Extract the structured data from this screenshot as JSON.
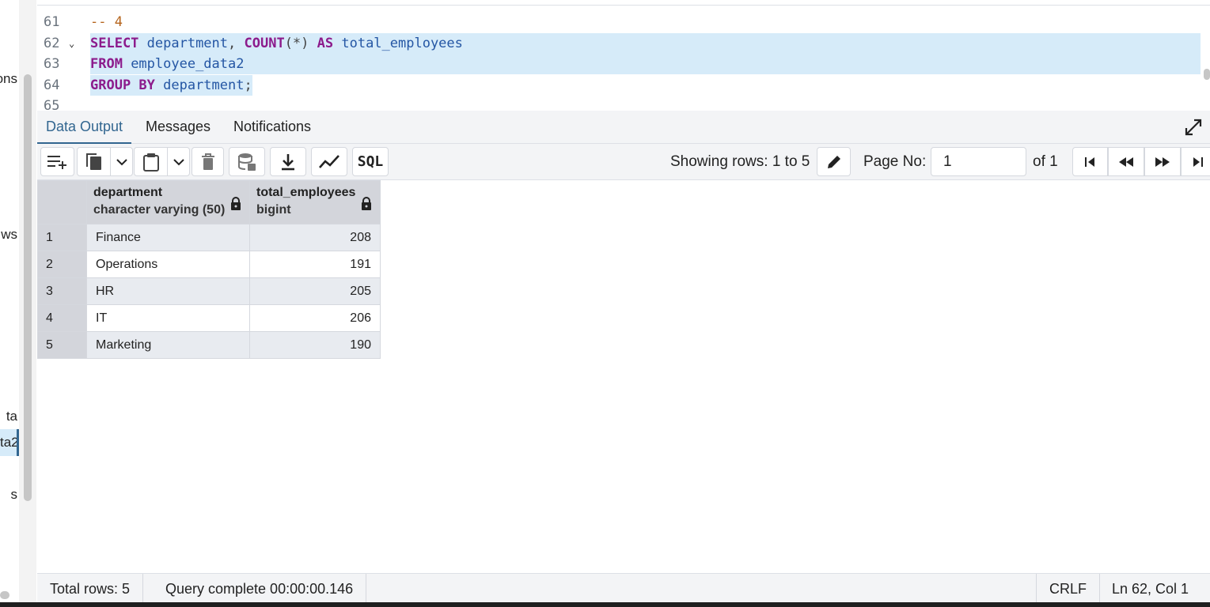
{
  "sidebar": {
    "fragments": [
      "ons",
      "ws",
      "ta",
      "ta2",
      "s"
    ]
  },
  "editor": {
    "lines": [
      {
        "num": "61",
        "tokens": [
          {
            "t": "cm",
            "v": "-- 4"
          }
        ]
      },
      {
        "num": "62",
        "fold": "⌄",
        "highlight": true,
        "tokens": [
          {
            "t": "kw",
            "v": "SELECT"
          },
          {
            "t": "id",
            "v": " department"
          },
          {
            "t": "pu",
            "v": ", "
          },
          {
            "t": "kw",
            "v": "COUNT"
          },
          {
            "t": "pu",
            "v": "(*) "
          },
          {
            "t": "kw",
            "v": "AS"
          },
          {
            "t": "id",
            "v": " total_employees"
          }
        ]
      },
      {
        "num": "63",
        "highlight": true,
        "tokens": [
          {
            "t": "kw",
            "v": "FROM"
          },
          {
            "t": "id",
            "v": " employee_data2"
          }
        ]
      },
      {
        "num": "64",
        "highlight": true,
        "partial": true,
        "tokens": [
          {
            "t": "kw",
            "v": "GROUP BY"
          },
          {
            "t": "id",
            "v": " department"
          },
          {
            "t": "pu",
            "v": ";"
          }
        ]
      },
      {
        "num": "65",
        "tokens": []
      }
    ]
  },
  "results": {
    "tabs": [
      "Data Output",
      "Messages",
      "Notifications"
    ],
    "active_tab": 0
  },
  "toolbar": {
    "showing_rows": "Showing rows: 1 to 5",
    "page_no_label": "Page No:",
    "page_value": "1",
    "of_label": "of 1",
    "sql_label": "SQL"
  },
  "grid": {
    "columns": [
      {
        "name": "department",
        "type": "character varying (50)"
      },
      {
        "name": "total_employees",
        "type": "bigint"
      }
    ],
    "rows": [
      {
        "n": "1",
        "department": "Finance",
        "total": "208"
      },
      {
        "n": "2",
        "department": "Operations",
        "total": "191"
      },
      {
        "n": "3",
        "department": "HR",
        "total": "205"
      },
      {
        "n": "4",
        "department": "IT",
        "total": "206"
      },
      {
        "n": "5",
        "department": "Marketing",
        "total": "190"
      }
    ]
  },
  "status": {
    "total_rows": "Total rows: 5",
    "query": "Query complete 00:00:00.146",
    "eol": "CRLF",
    "position": "Ln 62, Col 1"
  },
  "colors": {
    "accent": "#326690",
    "selection": "#d6ebf9",
    "keyword": "#8c1b8c",
    "identifier": "#2456a4",
    "comment": "#b5651d"
  }
}
